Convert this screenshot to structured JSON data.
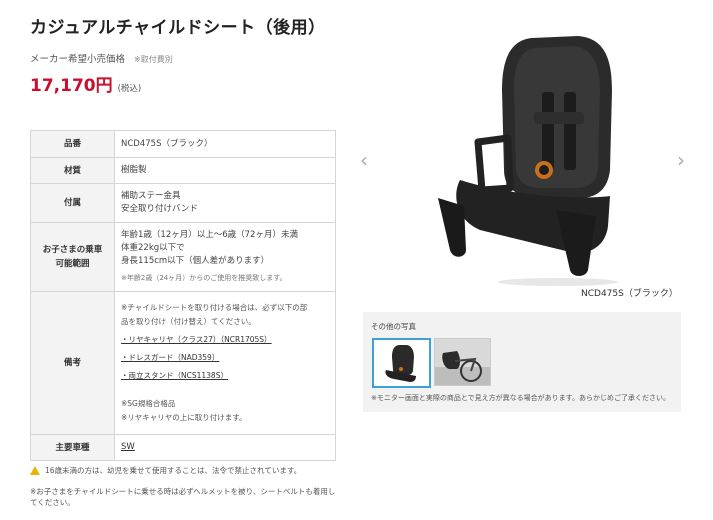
{
  "product": {
    "title": "カジュアルチャイルドシート（後用）",
    "price_label": "メーカー希望小売価格",
    "price_note": "※取付費別",
    "price": "17,170円",
    "tax": "(税込)"
  },
  "specs": {
    "rows": [
      {
        "label": "品番",
        "value": "NCD475S（ブラック）"
      },
      {
        "label": "材質",
        "value": "樹脂製"
      },
      {
        "label": "付属",
        "lines": [
          "補助ステー金具",
          "安全取り付けバンド"
        ]
      },
      {
        "label_lines": [
          "お子さまの乗車",
          "可能範囲"
        ],
        "lines": [
          "年齢1歳（12ヶ月）以上〜6歳（72ヶ月）未満",
          "体重22kg以下で",
          "身長115cm以下（個人差があります）"
        ],
        "small": "※年齢2歳（24ヶ月）からのご使用を推奨致します。"
      },
      {
        "label": "備考",
        "intro": [
          "※チャイルドシートを取り付ける場合は、必ず以下の部",
          "品を取り付け（付け替え）てください。"
        ],
        "items": [
          "・リヤキャリヤ（クラス27）（NCR1705S）",
          "・ドレスガード（NAD359）",
          "・両立スタンド（NCS1138S）"
        ],
        "extra": [
          "※SG規格合格品",
          "※リヤキャリヤの上に取り付けます。"
        ]
      },
      {
        "label": "主要車種",
        "value": "SW"
      }
    ]
  },
  "notices": {
    "warning": "16歳未満の方は、幼児を乗せて使用することは、法令で禁止されています。",
    "helmet": "※お子さまをチャイルドシートに乗せる時は必ずヘルメットを被り、シートベルトも着用してください。"
  },
  "gallery": {
    "caption": "NCD475S（ブラック）",
    "prev": "‹",
    "next": "›",
    "other_title": "その他の写真",
    "other_note": "※モニター画面と実際の商品とで見え方が異なる場合があります。あらかじめご了承ください。"
  },
  "colors": {
    "price": "#c8102e",
    "accent": "#3da0d8",
    "warning": "#e8b400"
  }
}
